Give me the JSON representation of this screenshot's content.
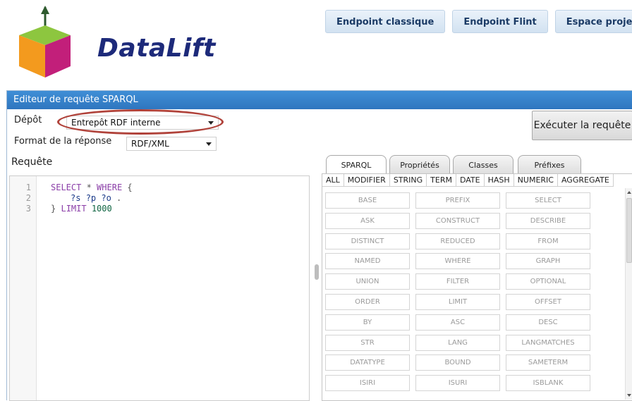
{
  "brand": {
    "name": "DataLift"
  },
  "nav": [
    {
      "label": "Endpoint classique"
    },
    {
      "label": "Endpoint Flint"
    },
    {
      "label": "Espace projets"
    }
  ],
  "panel": {
    "title": "Editeur de requête SPARQL",
    "depot_label": "Dépôt",
    "depot_value": "Entrepôt RDF interne",
    "format_label": "Format de la réponse",
    "format_value": "RDF/XML",
    "requete_label": "Requête",
    "execute_label": "Exécuter la requête"
  },
  "editor": {
    "lines": [
      {
        "n": "1",
        "parts": [
          "SELECT",
          " * ",
          "WHERE",
          " {"
        ]
      },
      {
        "n": "2",
        "parts": [
          "?s",
          " ",
          "?p",
          " ",
          "?o",
          " ."
        ]
      },
      {
        "n": "3",
        "parts": [
          "}",
          " ",
          "LIMIT",
          " ",
          "1000"
        ]
      }
    ]
  },
  "tabs": [
    {
      "label": "SPARQL",
      "active": true
    },
    {
      "label": "Propriétés",
      "active": false
    },
    {
      "label": "Classes",
      "active": false
    },
    {
      "label": "Préfixes",
      "active": false
    }
  ],
  "categories": [
    "ALL",
    "MODIFIER",
    "STRING",
    "TERM",
    "DATE",
    "HASH",
    "NUMERIC",
    "AGGREGATE"
  ],
  "keywords": [
    "BASE",
    "PREFIX",
    "SELECT",
    "ASK",
    "CONSTRUCT",
    "DESCRIBE",
    "DISTINCT",
    "REDUCED",
    "FROM",
    "NAMED",
    "WHERE",
    "GRAPH",
    "UNION",
    "FILTER",
    "OPTIONAL",
    "ORDER",
    "LIMIT",
    "OFFSET",
    "BY",
    "ASC",
    "DESC",
    "STR",
    "LANG",
    "LANGMATCHES",
    "DATATYPE",
    "BOUND",
    "SAMETERM",
    "ISIRI",
    "ISURI",
    "ISBLANK"
  ],
  "colors": {
    "title_bar": "#2f76bf",
    "nav_text": "#1b3b66",
    "highlight_ring": "#b0423a",
    "keyword": "#8b3fa8",
    "variable": "#1c3b8a"
  }
}
